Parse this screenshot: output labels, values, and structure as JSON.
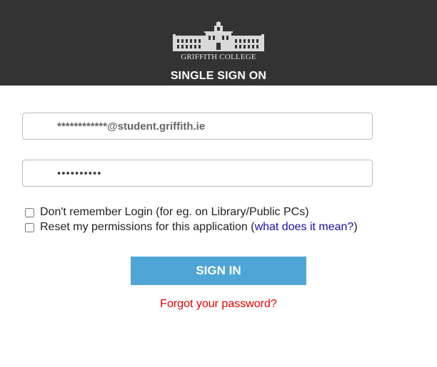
{
  "header": {
    "logo_text": "GRIFFITH COLLEGE",
    "title": "SINGLE SIGN ON",
    "background_color": "#333333"
  },
  "form": {
    "username_value": "************@student.griffith.ie",
    "password_value": "••••••••••",
    "dont_remember_label": "Don't remember Login (for eg. on Library/Public PCs)",
    "reset_label_prefix": "Reset my permissions for this application (",
    "reset_link": "what does it mean?",
    "reset_label_suffix": ")",
    "signin_label": "SIGN IN",
    "forgot_label": "Forgot your password?"
  },
  "colors": {
    "signin_button": "#4fa6d6",
    "forgot_link": "#e60000",
    "info_link": "#1a0dab"
  }
}
